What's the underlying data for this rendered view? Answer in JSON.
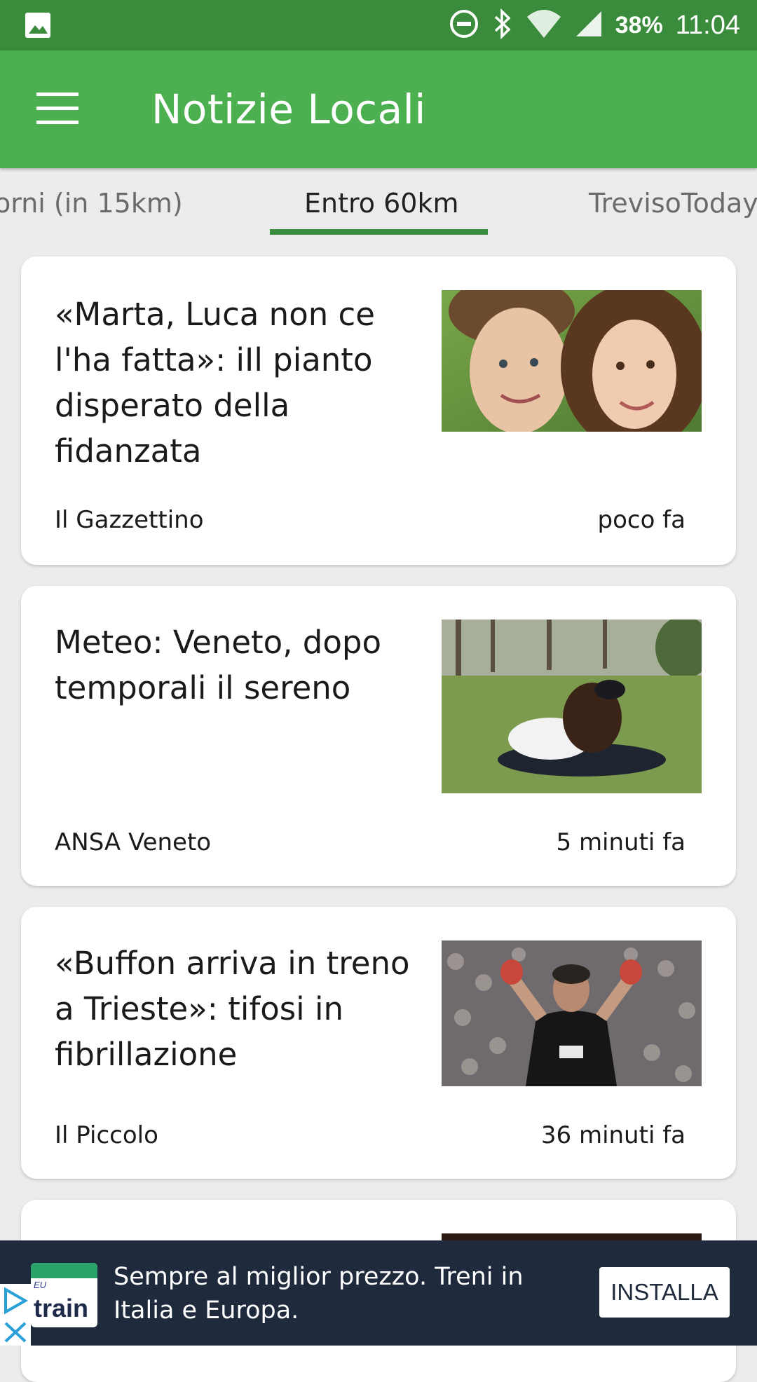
{
  "status_bar": {
    "battery": "38%",
    "time": "11:04",
    "icons": [
      "image-icon",
      "do-not-disturb-icon",
      "bluetooth-icon",
      "wifi-icon",
      "signal-icon"
    ]
  },
  "app_bar": {
    "title": "Notizie Locali",
    "menu_icon": "hamburger-menu-icon"
  },
  "tabs": [
    {
      "label": "orni (in 15km)",
      "active": false
    },
    {
      "label": "Entro 60km",
      "active": true
    },
    {
      "label": "TrevisoToday",
      "active": false
    }
  ],
  "colors": {
    "status_bar": "#3b8b3c",
    "app_bar": "#4caf50",
    "tab_indicator": "#388e3c",
    "background": "#ececec",
    "ad_background": "#1f2a3c"
  },
  "articles": [
    {
      "title": "«Marta, Luca non ce l'ha fatta»: iIl pianto disperato della fidanzata",
      "source": "Il Gazzettino",
      "time": "poco fa",
      "image": "couple-selfie-photo"
    },
    {
      "title": "Meteo: Veneto, dopo temporali il sereno",
      "source": "ANSA Veneto",
      "time": "5 minuti fa",
      "image": "couple-lying-on-grass-photo"
    },
    {
      "title": "«Buffon arriva in treno a Trieste»: tifosi in fibrillazione",
      "source": "Il Piccolo",
      "time": "36 minuti fa",
      "image": "goalkeeper-celebrating-photo"
    }
  ],
  "ad": {
    "logo_small": "EU",
    "logo_word": "train",
    "text": "Sempre al miglior prezzo. Treni in Italia e Europa.",
    "button": "INSTALLA",
    "icons": [
      "ad-choices-icon",
      "close-icon"
    ]
  }
}
